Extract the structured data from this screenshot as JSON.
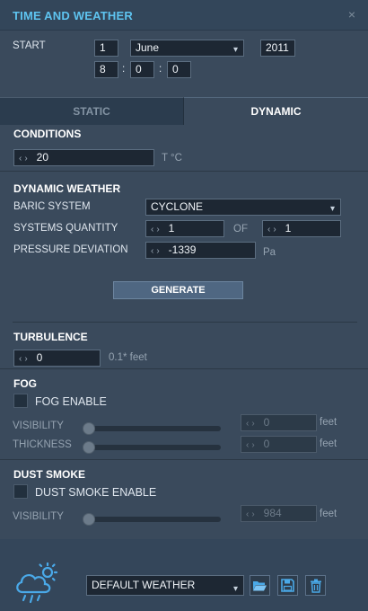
{
  "window": {
    "title": "TIME AND WEATHER",
    "close_glyph": "×"
  },
  "start": {
    "label": "START",
    "day": "1",
    "month": "June",
    "year": "2011",
    "hour": "8",
    "minute": "0",
    "second": "0",
    "sep": ":"
  },
  "tabs": {
    "static": "STATIC",
    "dynamic": "DYNAMIC",
    "active": "DYNAMIC"
  },
  "conditions": {
    "heading": "CONDITIONS",
    "temperature": "20",
    "unit": "T °C"
  },
  "dynamic_weather": {
    "heading": "DYNAMIC WEATHER",
    "baric_label": "BARIC SYSTEM",
    "baric_value": "CYCLONE",
    "quantity_label": "SYSTEMS QUANTITY",
    "quantity_value": "1",
    "of_label": "OF",
    "of_value": "1",
    "pressure_label": "PRESSURE DEVIATION",
    "pressure_value": "-1339",
    "pressure_unit": "Pa",
    "generate_label": "GENERATE"
  },
  "turbulence": {
    "heading": "TURBULENCE",
    "value": "0",
    "unit": "0.1* feet"
  },
  "fog": {
    "heading": "FOG",
    "enable_label": "FOG ENABLE",
    "enabled": false,
    "visibility_label": "VISIBILITY",
    "visibility_value": "0",
    "visibility_level": 0,
    "thickness_label": "THICKNESS",
    "thickness_value": "0",
    "thickness_level": 0,
    "unit": "feet"
  },
  "dust_smoke": {
    "heading": "DUST SMOKE",
    "enable_label": "DUST SMOKE ENABLE",
    "enabled": false,
    "visibility_label": "VISIBILITY",
    "visibility_value": "984",
    "visibility_level": 0,
    "unit": "feet"
  },
  "preset": {
    "selected": "DEFAULT WEATHER"
  },
  "icons": {
    "weather": "cloud-sun-rain-icon",
    "open": "folder-open-icon",
    "save": "save-icon",
    "delete": "trash-icon"
  },
  "colors": {
    "accent": "#5ec4f0",
    "panel": "#3a4a5c"
  }
}
